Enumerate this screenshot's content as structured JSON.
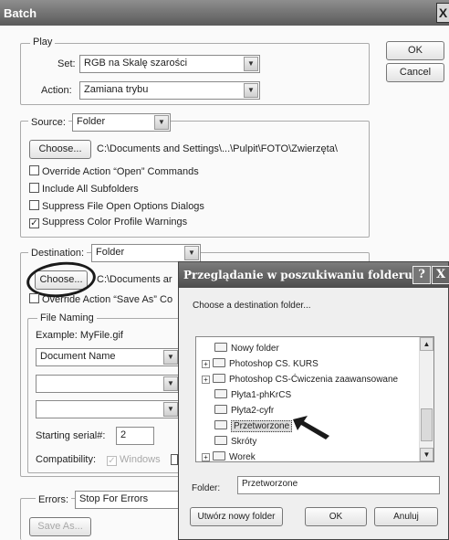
{
  "window": {
    "title": "Batch",
    "close_glyph": "X"
  },
  "buttons": {
    "ok": "OK",
    "cancel": "Cancel"
  },
  "play": {
    "legend": "Play",
    "set_label": "Set:",
    "set_value": "RGB na Skalę szarości",
    "action_label": "Action:",
    "action_value": "Zamiana trybu"
  },
  "source": {
    "label": "Source:",
    "value": "Folder",
    "choose": "Choose...",
    "path": "C:\\Documents and Settings\\...\\Pulpit\\FOTO\\Zwierzęta\\",
    "checkboxes": [
      {
        "label": "Override Action “Open” Commands",
        "checked": ""
      },
      {
        "label": "Include All Subfolders",
        "checked": ""
      },
      {
        "label": "Suppress File Open Options Dialogs",
        "checked": ""
      },
      {
        "label": "Suppress Color Profile Warnings",
        "checked": "✓"
      }
    ]
  },
  "destination": {
    "label": "Destination:",
    "value": "Folder",
    "choose": "Choose...",
    "path": "C:\\Documents ar",
    "override": "Override Action “Save As” Co",
    "file_naming": {
      "legend": "File Naming",
      "example": "Example: MyFile.gif",
      "field1": "Document Name",
      "field2": "",
      "field3": "",
      "serial_label": "Starting serial#:",
      "serial_value": "2",
      "compat_label": "Compatibility:",
      "compat_windows": "Windows"
    }
  },
  "errors": {
    "label": "Errors:",
    "value": "Stop For Errors",
    "save_as": "Save As..."
  },
  "dialog": {
    "title": "Przeglądanie w poszukiwaniu folderu",
    "help_glyph": "?",
    "close_glyph": "X",
    "instruction": "Choose a destination folder...",
    "tree": [
      {
        "label": "Nowy folder",
        "expander": ""
      },
      {
        "label": "Photoshop CS. KURS",
        "expander": "+"
      },
      {
        "label": "Photoshop CS-Ćwiczenia zaawansowane",
        "expander": "+"
      },
      {
        "label": "Płyta1-phKrCS",
        "expander": ""
      },
      {
        "label": "Płyta2-cyfr",
        "expander": ""
      },
      {
        "label": "Przetworzone",
        "expander": ""
      },
      {
        "label": "Skróty",
        "expander": ""
      },
      {
        "label": "Worek",
        "expander": "+"
      }
    ],
    "folder_label": "Folder:",
    "folder_value": "Przetworzone",
    "new_folder": "Utwórz nowy folder",
    "ok": "OK",
    "cancel": "Anuluj"
  },
  "colors": {
    "annotation": "#1a1a1a"
  }
}
